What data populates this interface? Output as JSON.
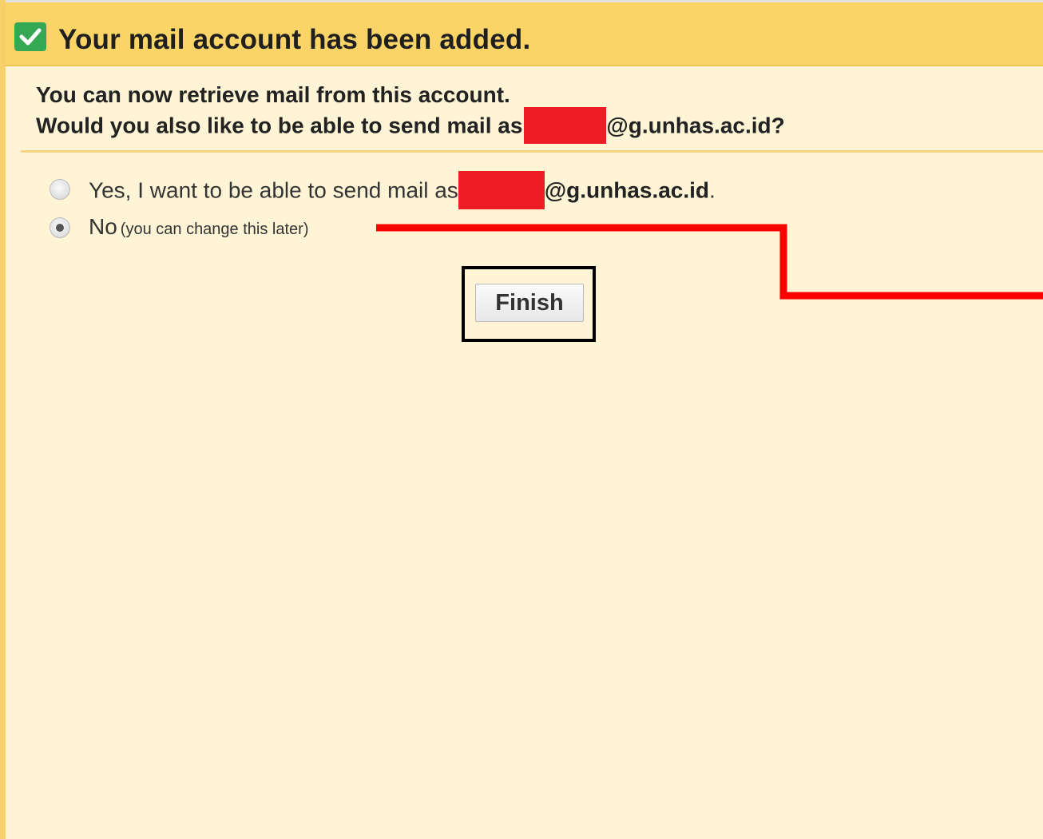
{
  "header": {
    "title": "Your mail account has been added.",
    "icon": "checkbox-checked-icon",
    "background": "#fad466"
  },
  "intro": {
    "line1": "You can now retrieve mail from this account.",
    "line2_prefix": "Would you also like to be able to send mail as",
    "line2_suffix": "@g.unhas.ac.id?"
  },
  "options": {
    "yes": {
      "label_prefix": "Yes, I want to be able to send mail as",
      "address_domain": "@g.unhas.ac.id",
      "trailing": ".",
      "checked": false
    },
    "no": {
      "label": "No",
      "note": "(you can change this later)",
      "checked": true
    }
  },
  "finish_button": {
    "label": "Finish"
  },
  "colors": {
    "panel": "#fff5d6",
    "redaction": "#ee1c24",
    "annotation_line": "#ff0000",
    "check_green": "#34a853"
  }
}
